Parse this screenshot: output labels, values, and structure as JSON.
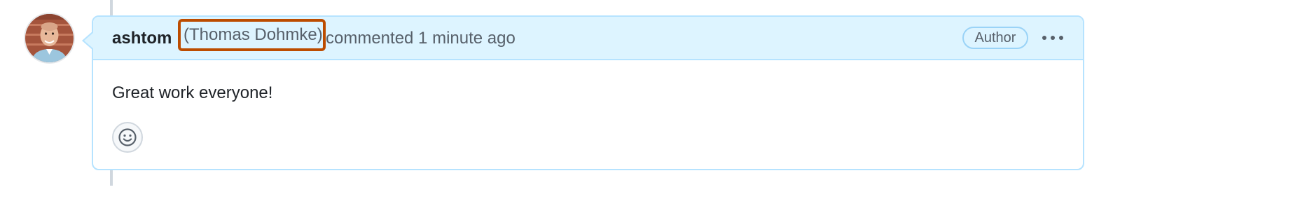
{
  "comment": {
    "author_login": "ashtom",
    "author_full_name": "(Thomas Dohmke)",
    "action_text": "commented 1 minute ago",
    "author_badge": "Author",
    "body": "Great work everyone!"
  },
  "icons": {
    "avatar": "user-avatar",
    "more": "kebab-horizontal-icon",
    "reaction": "smiley-icon"
  },
  "colors": {
    "header_bg": "#ddf4ff",
    "border": "#b6e3ff",
    "highlight_outline": "#bc4c00",
    "muted_text": "#57606a",
    "primary_text": "#1f2328"
  }
}
